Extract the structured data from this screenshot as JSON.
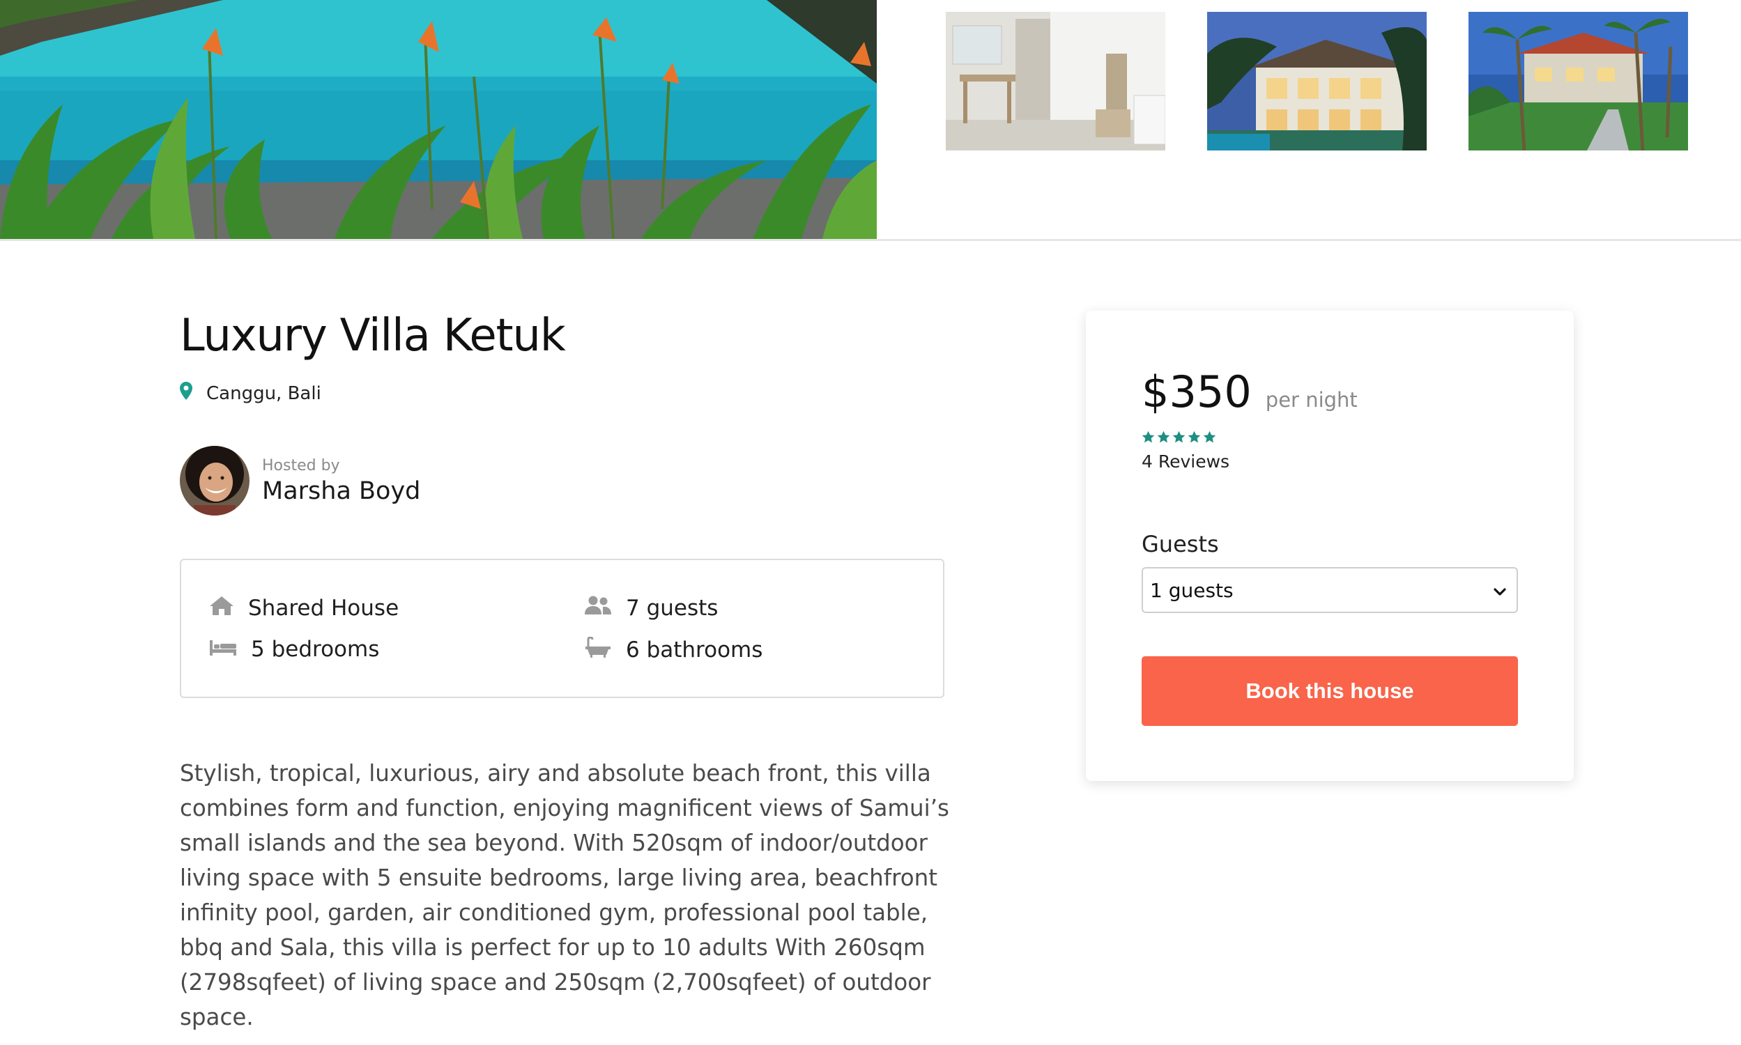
{
  "listing": {
    "title": "Luxury Villa Ketuk",
    "location": "Canggu, Bali",
    "host": {
      "hosted_by_label": "Hosted by",
      "name": "Marsha Boyd"
    },
    "features": [
      {
        "icon": "house-icon",
        "label": "Shared House"
      },
      {
        "icon": "guests-icon",
        "label": "7 guests"
      },
      {
        "icon": "bed-icon",
        "label": "5 bedrooms"
      },
      {
        "icon": "bathtub-icon",
        "label": "6 bathrooms"
      }
    ],
    "description": "Stylish, tropical, luxurious, airy and absolute beach front, this villa combines form and function, enjoying magnificent views of Samui’s small islands and the sea beyond. With 520sqm of indoor/outdoor living space with 5 ensuite bedrooms, large living area, beachfront infinity pool, garden, air conditioned gym, professional pool table, bbq and Sala, this villa is perfect for up to 10 adults With 260sqm (2798sqfeet) of living space and 250sqm (2,700sqfeet) of outdoor space."
  },
  "booking": {
    "price": "$350",
    "per_night": "per night",
    "rating": 5,
    "rating_max": 5,
    "reviews": "4 Reviews",
    "guests_label": "Guests",
    "guests_selected": "1 guests",
    "book_button": "Book this house"
  },
  "colors": {
    "accent": "#f9644a",
    "star": "#1e8e82",
    "pin": "#1e9e8e",
    "icon_gray": "#9a9a9a"
  }
}
